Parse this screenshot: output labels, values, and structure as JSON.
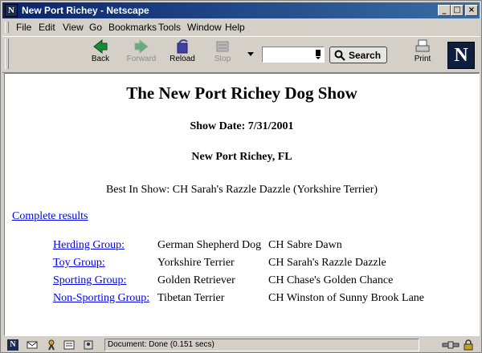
{
  "window": {
    "title": "New Port Richey - Netscape",
    "minimize_glyph": "_",
    "maximize_glyph": "□",
    "close_glyph": "×"
  },
  "menubar": {
    "items": [
      {
        "label": "File"
      },
      {
        "label": "Edit"
      },
      {
        "label": "View"
      },
      {
        "label": "Go"
      },
      {
        "label": "Bookmarks"
      },
      {
        "label": "Tools"
      },
      {
        "label": "Window"
      },
      {
        "label": "Help"
      }
    ]
  },
  "toolbar": {
    "back_label": "Back",
    "forward_label": "Forward",
    "reload_label": "Reload",
    "stop_label": "Stop",
    "search_value": "",
    "search_button_label": "Search",
    "print_label": "Print",
    "logo_letter": "N",
    "colors": {
      "back": "#1a8a3a",
      "forward": "#6aa880",
      "reload": "#4040a0",
      "stop": "#9a9a9a",
      "logo_bg": "#0e1e3f"
    }
  },
  "page": {
    "heading": "The New Port Richey Dog Show",
    "show_date": "Show Date: 7/31/2001",
    "location": "New Port Richey, FL",
    "best_in_show": "Best In Show: CH Sarah's Razzle Dazzle (Yorkshire Terrier)",
    "complete_results_link": "Complete results",
    "groups": [
      {
        "group": "Herding Group:",
        "breed": "German Shepherd Dog",
        "winner": "CH Sabre Dawn"
      },
      {
        "group": "Toy Group:",
        "breed": "Yorkshire Terrier",
        "winner": "CH Sarah's Razzle Dazzle"
      },
      {
        "group": "Sporting Group:",
        "breed": "Golden Retriever",
        "winner": "CH Chase's Golden Chance"
      },
      {
        "group": "Non-Sporting Group:",
        "breed": "Tibetan Terrier",
        "winner": "CH Winston of Sunny Brook Lane"
      }
    ]
  },
  "statusbar": {
    "text": "Document: Done (0.151 secs)"
  }
}
